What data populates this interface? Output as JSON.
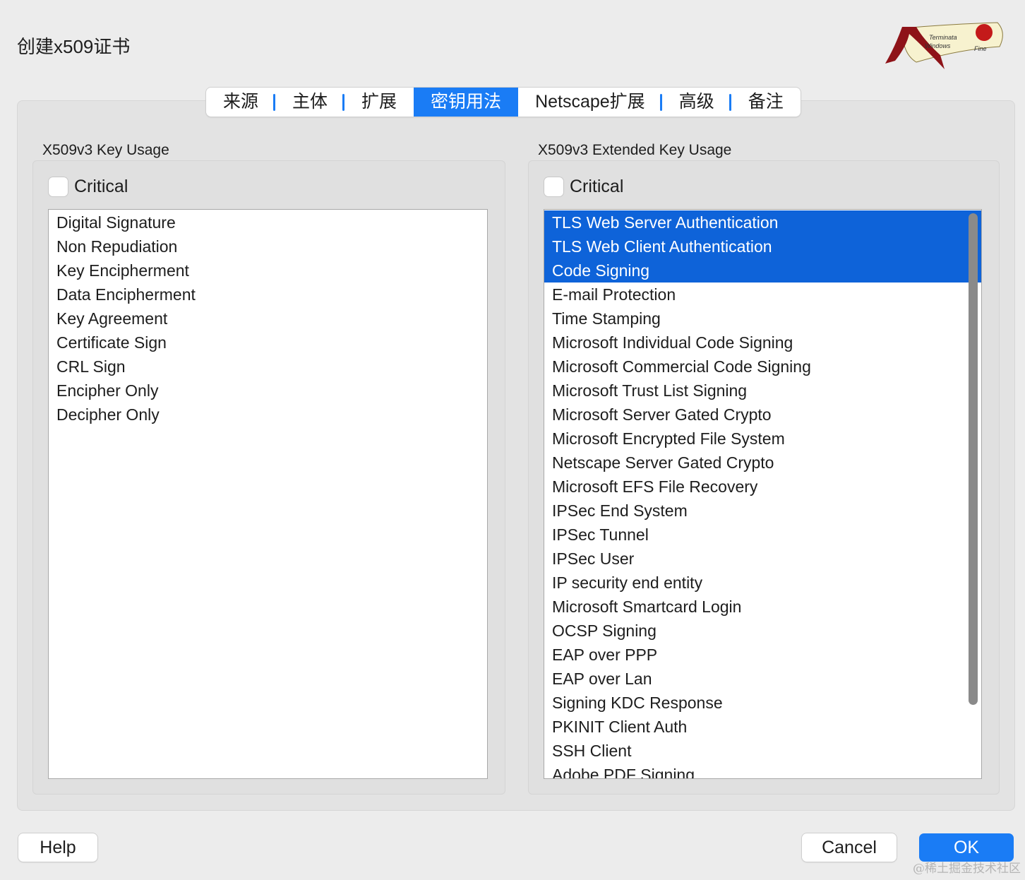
{
  "window": {
    "title": "创建x509证书",
    "logo_text": "Terminata Windows Fine"
  },
  "tabs": [
    {
      "label": "来源"
    },
    {
      "label": "主体"
    },
    {
      "label": "扩展"
    },
    {
      "label": "密钥用法",
      "active": true
    },
    {
      "label": "Netscape扩展"
    },
    {
      "label": "高级"
    },
    {
      "label": "备注"
    }
  ],
  "key_usage": {
    "label": "X509v3 Key Usage",
    "critical_label": "Critical",
    "critical": false,
    "items": [
      "Digital Signature",
      "Non Repudiation",
      "Key Encipherment",
      "Data Encipherment",
      "Key Agreement",
      "Certificate Sign",
      "CRL Sign",
      "Encipher Only",
      "Decipher Only"
    ]
  },
  "extended_key_usage": {
    "label": "X509v3 Extended Key Usage",
    "critical_label": "Critical",
    "critical": false,
    "selected": [
      "TLS Web Server Authentication",
      "TLS Web Client Authentication",
      "Code Signing"
    ],
    "items": [
      "TLS Web Server Authentication",
      "TLS Web Client Authentication",
      "Code Signing",
      "E-mail Protection",
      "Time Stamping",
      "Microsoft Individual Code Signing",
      "Microsoft Commercial Code Signing",
      "Microsoft Trust List Signing",
      "Microsoft Server Gated Crypto",
      "Microsoft Encrypted File System",
      "Netscape Server Gated Crypto",
      "Microsoft EFS File Recovery",
      "IPSec End System",
      "IPSec Tunnel",
      "IPSec User",
      "IP security end entity",
      "Microsoft Smartcard Login",
      "OCSP Signing",
      "EAP over PPP",
      "EAP over Lan",
      "Signing KDC Response",
      "PKINIT Client Auth",
      "SSH Client",
      "Adobe PDF Signing"
    ]
  },
  "buttons": {
    "help": "Help",
    "cancel": "Cancel",
    "ok": "OK"
  },
  "watermark": "@稀土掘金技术社区",
  "colors": {
    "accent": "#1a7cf5",
    "selection": "#0e63d9"
  }
}
